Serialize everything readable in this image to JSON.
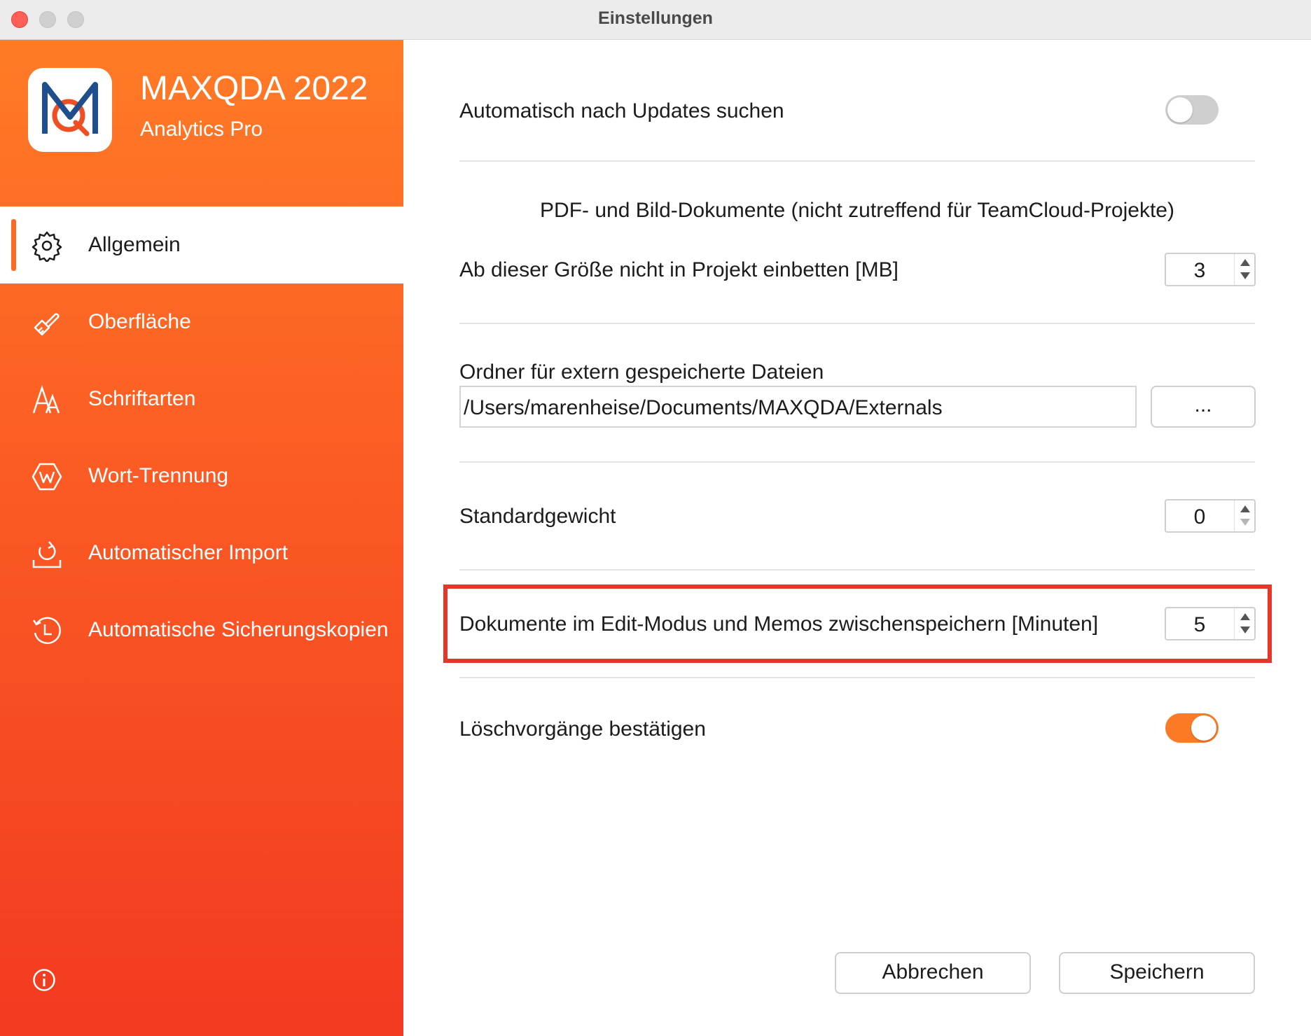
{
  "window": {
    "title": "Einstellungen"
  },
  "brand": {
    "title": "MAXQDA 2022",
    "subtitle": "Analytics Pro"
  },
  "sidebar": {
    "items": [
      {
        "label": "Allgemein",
        "icon": "gear-icon",
        "active": true
      },
      {
        "label": "Oberfläche",
        "icon": "paintbrush-icon",
        "active": false
      },
      {
        "label": "Schriftarten",
        "icon": "fonts-icon",
        "active": false
      },
      {
        "label": "Wort-Trennung",
        "icon": "hyphenation-icon",
        "active": false
      },
      {
        "label": "Automatischer Import",
        "icon": "auto-import-icon",
        "active": false
      },
      {
        "label": "Automatische Sicherungskopien",
        "icon": "backup-history-icon",
        "active": false
      }
    ],
    "info_icon": "info-icon"
  },
  "settings": {
    "updates": {
      "label": "Automatisch nach Updates suchen",
      "enabled": false
    },
    "pdf_section_heading": "PDF- und Bild-Dokumente (nicht zutreffend für TeamCloud-Projekte)",
    "embed_limit": {
      "label": "Ab dieser Größe nicht in Projekt einbetten [MB]",
      "value": "3"
    },
    "external_folder": {
      "label": "Ordner für extern gespeicherte Dateien",
      "path": "/Users/marenheise/Documents/MAXQDA/Externals",
      "browse_label": "..."
    },
    "default_weight": {
      "label": "Standardgewicht",
      "value": "0"
    },
    "autosave": {
      "label": "Dokumente im Edit-Modus und Memos zwischenspeichern [Minuten]",
      "value": "5"
    },
    "confirm_delete": {
      "label": "Löschvorgänge bestätigen",
      "enabled": true
    }
  },
  "buttons": {
    "cancel_label": "Abbrechen",
    "save_label": "Speichern"
  },
  "colors": {
    "accent": "#fb7a26",
    "highlight": "#e8352a",
    "sidebar_top": "#ff7b26",
    "sidebar_bottom": "#f23a21"
  }
}
